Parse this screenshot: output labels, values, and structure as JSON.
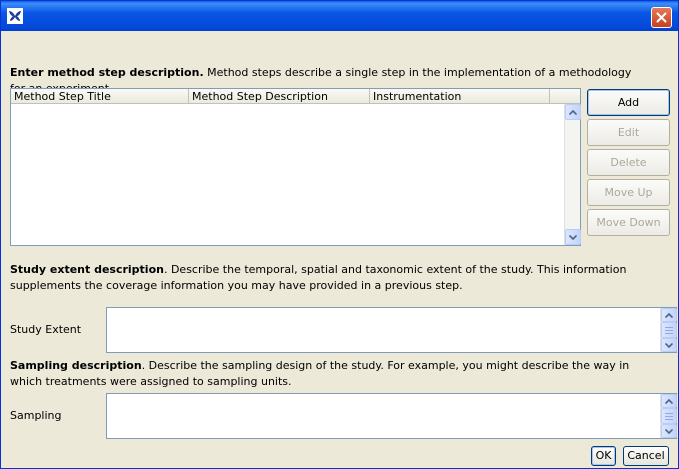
{
  "colors": {
    "titlebar": "#0549d8",
    "window_bg": "#ece9d8",
    "close": "#c5401f",
    "field_border": "#7f9db9"
  },
  "titlebar": {
    "icon": "butterfly-icon",
    "close_icon": "close-icon"
  },
  "method_step": {
    "heading": "Enter method step description.",
    "description": " Method steps describe a single step in the implementation of a methodology for an experiment.",
    "columns": [
      "Method Step Title",
      "Method Step Description",
      "Instrumentation"
    ],
    "rows": []
  },
  "buttons": {
    "add": "Add",
    "edit": "Edit",
    "delete": "Delete",
    "move_up": "Move Up",
    "move_down": "Move Down",
    "ok": "OK",
    "cancel": "Cancel"
  },
  "study_extent": {
    "heading": "Study extent description",
    "description": ". Describe the temporal, spatial and taxonomic extent of the study. This information supplements the coverage information you may have provided in a previous step.",
    "label": "Study Extent",
    "value": ""
  },
  "sampling": {
    "heading": "Sampling description",
    "description": ". Describe the sampling design of the study. For example, you might describe the way in which treatments were assigned to sampling units.",
    "label": "Sampling",
    "value": ""
  }
}
